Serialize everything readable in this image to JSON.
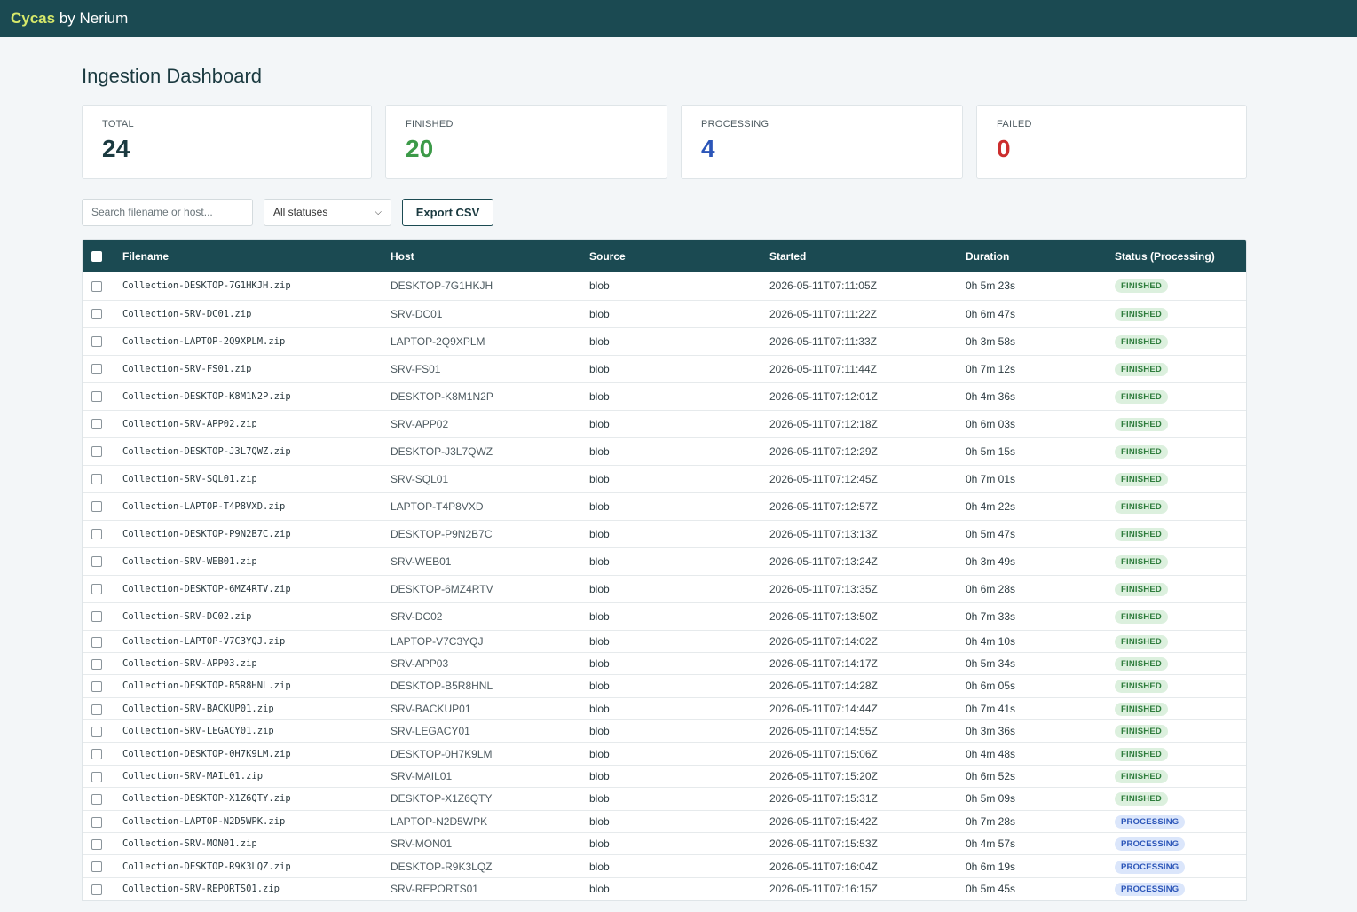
{
  "app": {
    "brand_accent": "Cycas",
    "brand_rest": " by Nerium"
  },
  "page": {
    "title": "Ingestion Dashboard"
  },
  "stats": [
    {
      "label": "TOTAL",
      "value": "24",
      "color": "#1b3a40"
    },
    {
      "label": "FINISHED",
      "value": "20",
      "color": "#3c9a48"
    },
    {
      "label": "PROCESSING",
      "value": "4",
      "color": "#2b55b8"
    },
    {
      "label": "FAILED",
      "value": "0",
      "color": "#cc2e2e"
    }
  ],
  "toolbar": {
    "search_placeholder": "Search filename or host...",
    "status_selected": "All statuses",
    "export_label": "Export CSV"
  },
  "table": {
    "headers": [
      "Filename",
      "Host",
      "Source",
      "Started",
      "Duration",
      "Status (Processing)"
    ],
    "rows": [
      {
        "filename": "Collection-DESKTOP-7G1HKJH.zip",
        "host": "DESKTOP-7G1HKJH",
        "source": "blob",
        "started": "2026-05-11T07:11:05Z",
        "duration": "0h 5m 23s",
        "status": "FINISHED"
      },
      {
        "filename": "Collection-SRV-DC01.zip",
        "host": "SRV-DC01",
        "source": "blob",
        "started": "2026-05-11T07:11:22Z",
        "duration": "0h 6m 47s",
        "status": "FINISHED"
      },
      {
        "filename": "Collection-LAPTOP-2Q9XPLM.zip",
        "host": "LAPTOP-2Q9XPLM",
        "source": "blob",
        "started": "2026-05-11T07:11:33Z",
        "duration": "0h 3m 58s",
        "status": "FINISHED"
      },
      {
        "filename": "Collection-SRV-FS01.zip",
        "host": "SRV-FS01",
        "source": "blob",
        "started": "2026-05-11T07:11:44Z",
        "duration": "0h 7m 12s",
        "status": "FINISHED"
      },
      {
        "filename": "Collection-DESKTOP-K8M1N2P.zip",
        "host": "DESKTOP-K8M1N2P",
        "source": "blob",
        "started": "2026-05-11T07:12:01Z",
        "duration": "0h 4m 36s",
        "status": "FINISHED"
      },
      {
        "filename": "Collection-SRV-APP02.zip",
        "host": "SRV-APP02",
        "source": "blob",
        "started": "2026-05-11T07:12:18Z",
        "duration": "0h 6m 03s",
        "status": "FINISHED"
      },
      {
        "filename": "Collection-DESKTOP-J3L7QWZ.zip",
        "host": "DESKTOP-J3L7QWZ",
        "source": "blob",
        "started": "2026-05-11T07:12:29Z",
        "duration": "0h 5m 15s",
        "status": "FINISHED"
      },
      {
        "filename": "Collection-SRV-SQL01.zip",
        "host": "SRV-SQL01",
        "source": "blob",
        "started": "2026-05-11T07:12:45Z",
        "duration": "0h 7m 01s",
        "status": "FINISHED"
      },
      {
        "filename": "Collection-LAPTOP-T4P8VXD.zip",
        "host": "LAPTOP-T4P8VXD",
        "source": "blob",
        "started": "2026-05-11T07:12:57Z",
        "duration": "0h 4m 22s",
        "status": "FINISHED"
      },
      {
        "filename": "Collection-DESKTOP-P9N2B7C.zip",
        "host": "DESKTOP-P9N2B7C",
        "source": "blob",
        "started": "2026-05-11T07:13:13Z",
        "duration": "0h 5m 47s",
        "status": "FINISHED"
      },
      {
        "filename": "Collection-SRV-WEB01.zip",
        "host": "SRV-WEB01",
        "source": "blob",
        "started": "2026-05-11T07:13:24Z",
        "duration": "0h 3m 49s",
        "status": "FINISHED"
      },
      {
        "filename": "Collection-DESKTOP-6MZ4RTV.zip",
        "host": "DESKTOP-6MZ4RTV",
        "source": "blob",
        "started": "2026-05-11T07:13:35Z",
        "duration": "0h 6m 28s",
        "status": "FINISHED"
      },
      {
        "filename": "Collection-SRV-DC02.zip",
        "host": "SRV-DC02",
        "source": "blob",
        "started": "2026-05-11T07:13:50Z",
        "duration": "0h 7m 33s",
        "status": "FINISHED"
      },
      {
        "filename": "Collection-LAPTOP-V7C3YQJ.zip",
        "host": "LAPTOP-V7C3YQJ",
        "source": "blob",
        "started": "2026-05-11T07:14:02Z",
        "duration": "0h 4m 10s",
        "status": "FINISHED"
      },
      {
        "filename": "Collection-SRV-APP03.zip",
        "host": "SRV-APP03",
        "source": "blob",
        "started": "2026-05-11T07:14:17Z",
        "duration": "0h 5m 34s",
        "status": "FINISHED"
      },
      {
        "filename": "Collection-DESKTOP-B5R8HNL.zip",
        "host": "DESKTOP-B5R8HNL",
        "source": "blob",
        "started": "2026-05-11T07:14:28Z",
        "duration": "0h 6m 05s",
        "status": "FINISHED"
      },
      {
        "filename": "Collection-SRV-BACKUP01.zip",
        "host": "SRV-BACKUP01",
        "source": "blob",
        "started": "2026-05-11T07:14:44Z",
        "duration": "0h 7m 41s",
        "status": "FINISHED"
      },
      {
        "filename": "Collection-SRV-LEGACY01.zip",
        "host": "SRV-LEGACY01",
        "source": "blob",
        "started": "2026-05-11T07:14:55Z",
        "duration": "0h 3m 36s",
        "status": "FINISHED"
      },
      {
        "filename": "Collection-DESKTOP-0H7K9LM.zip",
        "host": "DESKTOP-0H7K9LM",
        "source": "blob",
        "started": "2026-05-11T07:15:06Z",
        "duration": "0h 4m 48s",
        "status": "FINISHED"
      },
      {
        "filename": "Collection-SRV-MAIL01.zip",
        "host": "SRV-MAIL01",
        "source": "blob",
        "started": "2026-05-11T07:15:20Z",
        "duration": "0h 6m 52s",
        "status": "FINISHED"
      },
      {
        "filename": "Collection-DESKTOP-X1Z6QTY.zip",
        "host": "DESKTOP-X1Z6QTY",
        "source": "blob",
        "started": "2026-05-11T07:15:31Z",
        "duration": "0h 5m 09s",
        "status": "FINISHED"
      },
      {
        "filename": "Collection-LAPTOP-N2D5WPK.zip",
        "host": "LAPTOP-N2D5WPK",
        "source": "blob",
        "started": "2026-05-11T07:15:42Z",
        "duration": "0h 7m 28s",
        "status": "PROCESSING"
      },
      {
        "filename": "Collection-SRV-MON01.zip",
        "host": "SRV-MON01",
        "source": "blob",
        "started": "2026-05-11T07:15:53Z",
        "duration": "0h 4m 57s",
        "status": "PROCESSING"
      },
      {
        "filename": "Collection-DESKTOP-R9K3LQZ.zip",
        "host": "DESKTOP-R9K3LQZ",
        "source": "blob",
        "started": "2026-05-11T07:16:04Z",
        "duration": "0h 6m 19s",
        "status": "PROCESSING"
      },
      {
        "filename": "Collection-SRV-REPORTS01.zip",
        "host": "SRV-REPORTS01",
        "source": "blob",
        "started": "2026-05-11T07:16:15Z",
        "duration": "0h 5m 45s",
        "status": "PROCESSING"
      }
    ]
  }
}
